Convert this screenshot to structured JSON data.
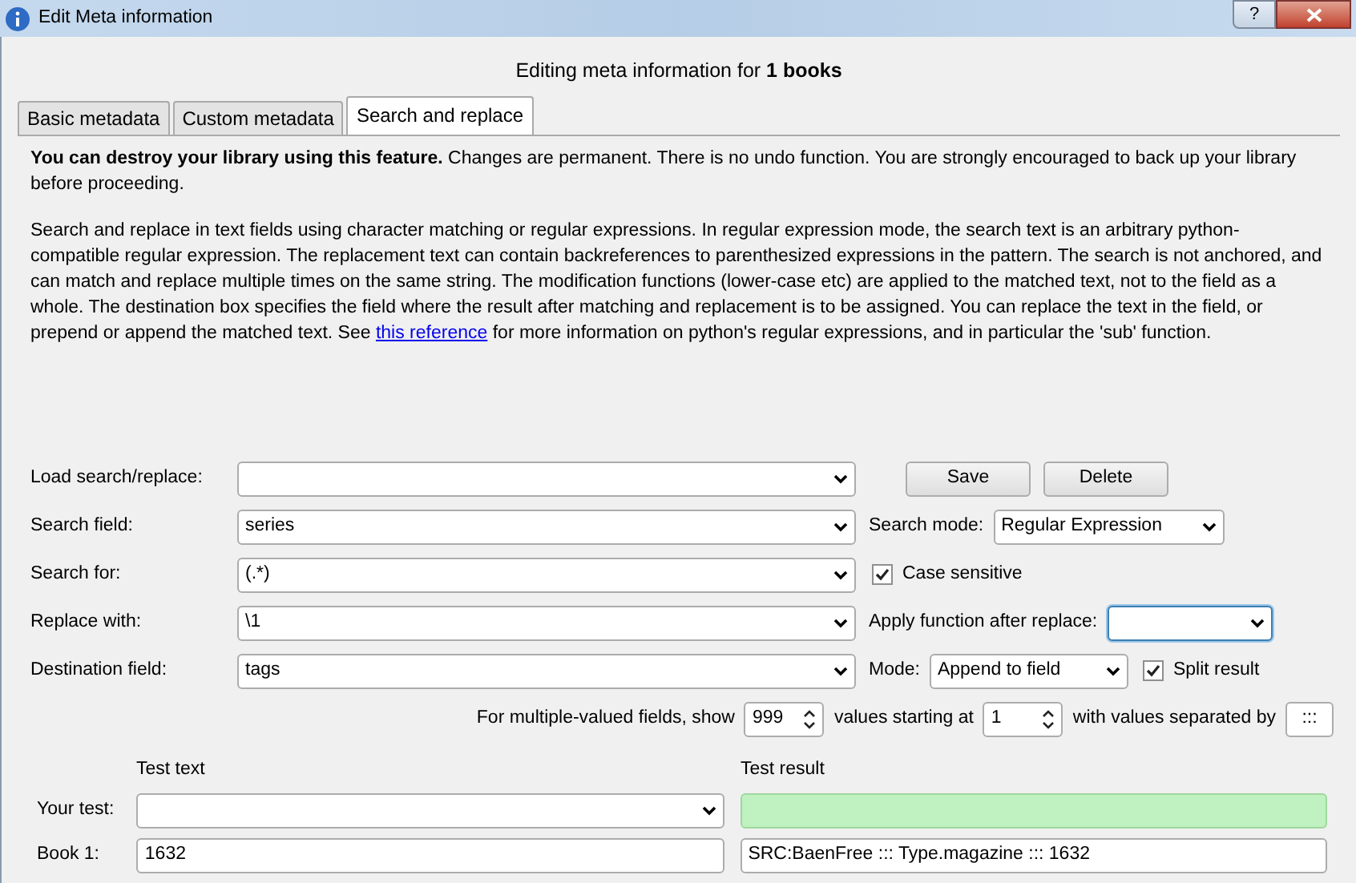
{
  "window": {
    "title": "Edit Meta information",
    "help": "?"
  },
  "header": "Editing meta information for **1 books**",
  "tabs": [
    {
      "label": "Basic metadata",
      "selected": false
    },
    {
      "label": "Custom metadata",
      "selected": false
    },
    {
      "label": "Search and replace",
      "selected": true
    }
  ],
  "warning": {
    "bold": "You can destroy your library using this feature.",
    "text": "Changes are permanent. There is no undo function. You are strongly encouraged to back up your library before proceeding."
  },
  "description": {
    "before": "Search and replace in text fields using character matching or regular expressions. In regular expression mode, the search text is an arbitrary python-compatible regular expression. The replacement text can contain backreferences to parenthesized expressions in the pattern. The search is not anchored, and can match and replace multiple times on the same string. The modification functions (lower-case etc) are applied to the matched text, not to the field as a whole. The destination box specifies the field where the result after matching and replacement is to be assigned. You can replace the text in the field, or prepend or append the matched text. See",
    "link": "this reference",
    "after": "for more information on python's regular expressions, and in particular the 'sub' function."
  },
  "load": {
    "label": "Load search/replace:",
    "buttons": [
      "Save",
      "Delete"
    ]
  },
  "search_field": {
    "label": "Search field:",
    "value": "series"
  },
  "search_mode": {
    "label": "Search mode:",
    "value": "Regular Expression"
  },
  "search_for": {
    "label": "Search for:",
    "value": "(.*)"
  },
  "case_sensitive": {
    "label": "Case sensitive",
    "checked": true
  },
  "replace_with": {
    "label": "Replace with:",
    "value": "\\1"
  },
  "apply_function": {
    "label": "Apply function after replace:",
    "focused": true
  },
  "destination": {
    "label": "Destination field:",
    "value": "tags"
  },
  "mode": {
    "label": "Mode:",
    "value": "Append to field"
  },
  "split_result": {
    "label": "Split result",
    "checked": true
  },
  "multi": {
    "show_label": "For multiple-valued fields, show",
    "count": "999",
    "start_label": "values starting at",
    "start": "1",
    "sep_label": "with values separated by",
    "separator": ":::"
  },
  "test": {
    "text_heading": "Test text",
    "result_heading": "Test result",
    "your_test_label": "Your test:",
    "book_label": "Book 1:",
    "book_value": "1632",
    "book_result": "SRC:BaenFree ::: Type.magazine ::: 1632"
  }
}
